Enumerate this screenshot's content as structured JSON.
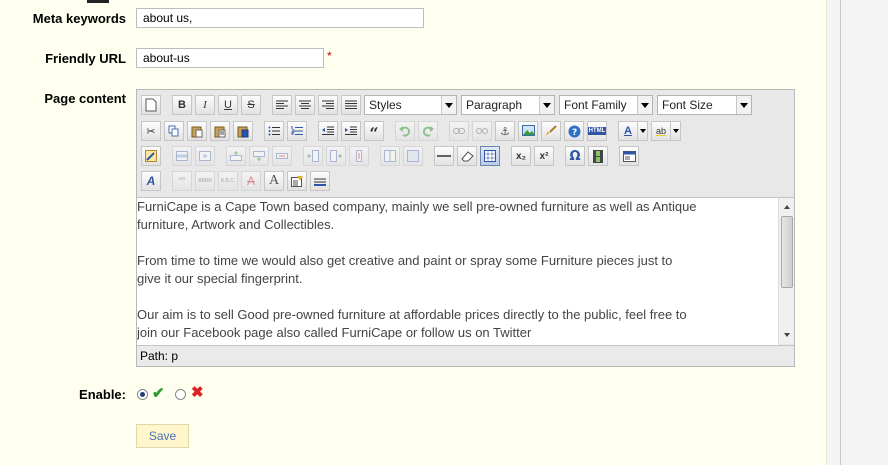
{
  "form": {
    "meta_keywords_label": "Meta keywords",
    "meta_keywords_value": "about us,",
    "friendly_url_label": "Friendly URL",
    "friendly_url_value": "about-us",
    "required_mark": "*",
    "page_content_label": "Page content",
    "enable_label": "Enable:",
    "save_label": "Save"
  },
  "editor": {
    "styles_select": "Styles",
    "paragraph_select": "Paragraph",
    "font_family_select": "Font Family",
    "font_size_select": "Font Size",
    "bold": "B",
    "italic": "I",
    "underline": "U",
    "strikethrough": "S",
    "quote_glyph": "“",
    "subscript": "x₂",
    "superscript": "x²",
    "omega": "Ω",
    "font_color_glyph": "A",
    "backcolor_glyph": "ab",
    "html_glyph": "HTML",
    "styleprops_glyph": "A",
    "cite_glyph": "“”",
    "abbr_glyph": "ABBR",
    "acronym_glyph": "A.B.C.",
    "del_glyph": "A",
    "ins_glyph": "A",
    "content_paragraphs": [
      "FurniCape is a Cape Town based company, mainly we sell pre-owned furniture as well as Antique furniture, Artwork and Collectibles.",
      "From time to time we would also get creative and paint or spray some Furniture pieces just to give it our special fingerprint.",
      "Our aim is to sell Good pre-owned furniture at affordable prices directly to the public, feel free to join our Facebook page also called FurniCape or follow us on Twitter"
    ],
    "path_text": "Path: p"
  },
  "enable": {
    "yes_selected": true,
    "check_glyph": "✔",
    "cross_glyph": "✖"
  }
}
